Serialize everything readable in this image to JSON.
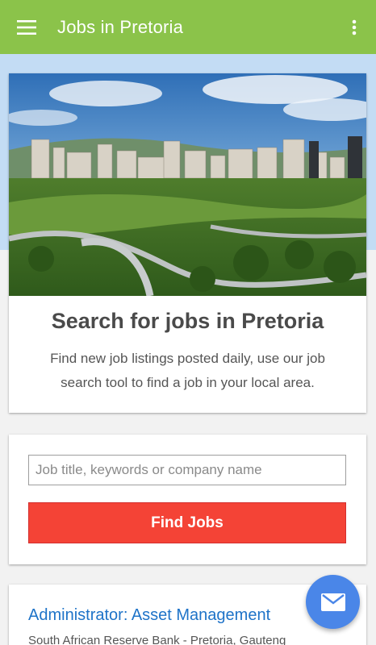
{
  "app_bar": {
    "title": "Jobs in Pretoria",
    "menu_icon": "hamburger-menu-icon",
    "overflow_icon": "more-vert-icon",
    "color": "#8bc34a"
  },
  "hero": {
    "heading": "Search for jobs in Pretoria",
    "description": "Find new job listings posted daily, use our job search tool to find a job in your local area."
  },
  "search": {
    "placeholder": "Job title, keywords or company name",
    "value": "",
    "button_label": "Find Jobs",
    "button_color": "#f44336"
  },
  "jobs": [
    {
      "title": "Administrator: Asset Management",
      "company_location": "South African Reserve Bank - Pretoria, Gauteng"
    }
  ],
  "fab": {
    "icon": "email-icon",
    "color": "#4a86e8"
  }
}
